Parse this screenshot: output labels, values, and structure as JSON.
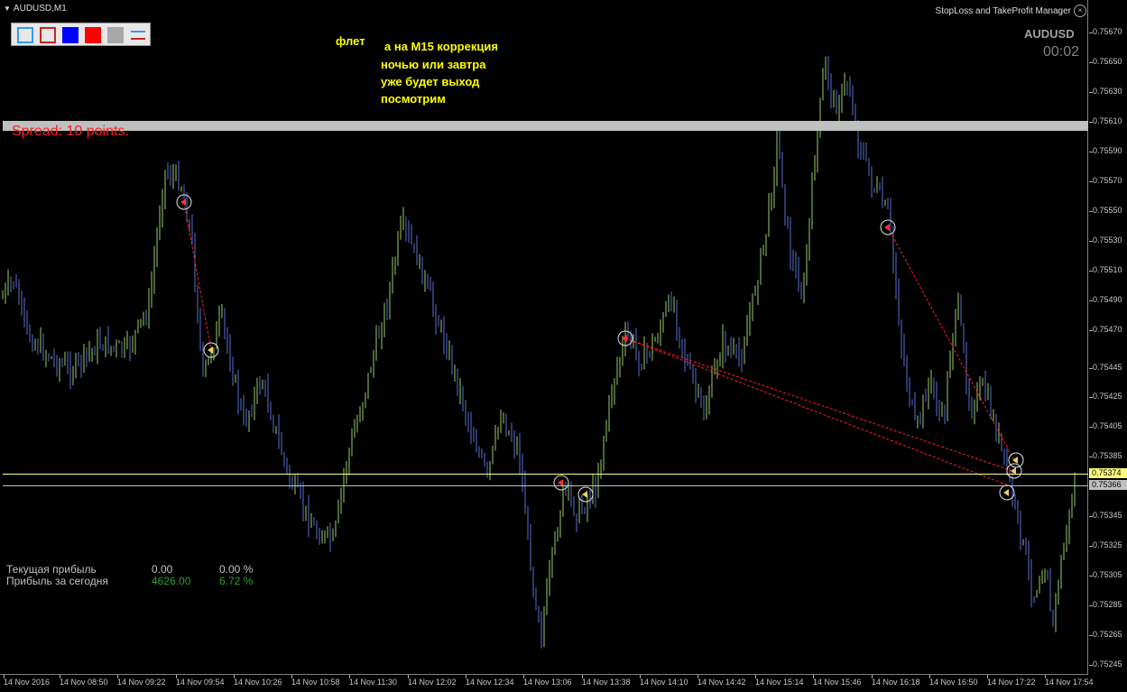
{
  "window": {
    "title": "AUDUSD,M1",
    "manager_title": "StopLoss and TakeProfit Manager",
    "close_glyph": "×"
  },
  "toolbar": {
    "buttons": [
      {
        "name": "outline-blue-square-icon",
        "fill": "transparent",
        "border": "#3399ff"
      },
      {
        "name": "outline-red-square-icon",
        "fill": "transparent",
        "border": "#cc2222"
      },
      {
        "name": "blue-square-icon",
        "fill": "#0000ff",
        "border": "#0000ff"
      },
      {
        "name": "red-square-icon",
        "fill": "#ff0000",
        "border": "#ff0000"
      },
      {
        "name": "gray-square-icon",
        "fill": "#a8a8a8",
        "border": "#a8a8a8"
      },
      {
        "name": "lines-icon",
        "fill": "transparent",
        "border": "transparent"
      }
    ]
  },
  "symbol": "AUDUSD",
  "timer": "00:02",
  "notes": [
    "флет",
    "а на М15 коррекция",
    "ночью или завтра",
    "уже будет выход",
    "посмотрим"
  ],
  "spread_text": "Spread: 10 points.",
  "price_axis": {
    "labels": [
      "0.75670",
      "0.75650",
      "0.75630",
      "0.75610",
      "0.75590",
      "0.75570",
      "0.75550",
      "0.75530",
      "0.75510",
      "0.75490",
      "0.75470",
      "0.75445",
      "0.75425",
      "0.75405",
      "0.75385",
      "0.75345",
      "0.75325",
      "0.75305",
      "0.75285",
      "0.75265",
      "0.75245"
    ],
    "bid_tag": "0.75374",
    "ask_tag": "0.75366"
  },
  "time_axis": {
    "labels": [
      "14 Nov 2016",
      "14 Nov 08:50",
      "14 Nov 09:22",
      "14 Nov 09:54",
      "14 Nov 10:26",
      "14 Nov 10:58",
      "14 Nov 11:30",
      "14 Nov 12:02",
      "14 Nov 12:34",
      "14 Nov 13:06",
      "14 Nov 13:38",
      "14 Nov 14:10",
      "14 Nov 14:42",
      "14 Nov 15:14",
      "14 Nov 15:46",
      "14 Nov 16:18",
      "14 Nov 16:50",
      "14 Nov 17:22",
      "14 Nov 17:54"
    ]
  },
  "profit_panel": {
    "current": {
      "label": "Текущая прибыль",
      "value": "0.00",
      "percent": "0.00 %"
    },
    "today": {
      "label": "Прибыль за сегодня",
      "value": "4626.00",
      "percent": "6.72 %"
    }
  },
  "colors": {
    "background": "#000000",
    "bull": "#9acd6a",
    "bear": "#5a6fd0",
    "note": "#ffff00",
    "spread": "#ff2020",
    "bid_line": "#ffff80",
    "ask_line": "#c0c0c0",
    "profit_value": "#2e9e2e",
    "profit_label": "#c0c0c0",
    "trade_line": "#ff2020"
  }
}
